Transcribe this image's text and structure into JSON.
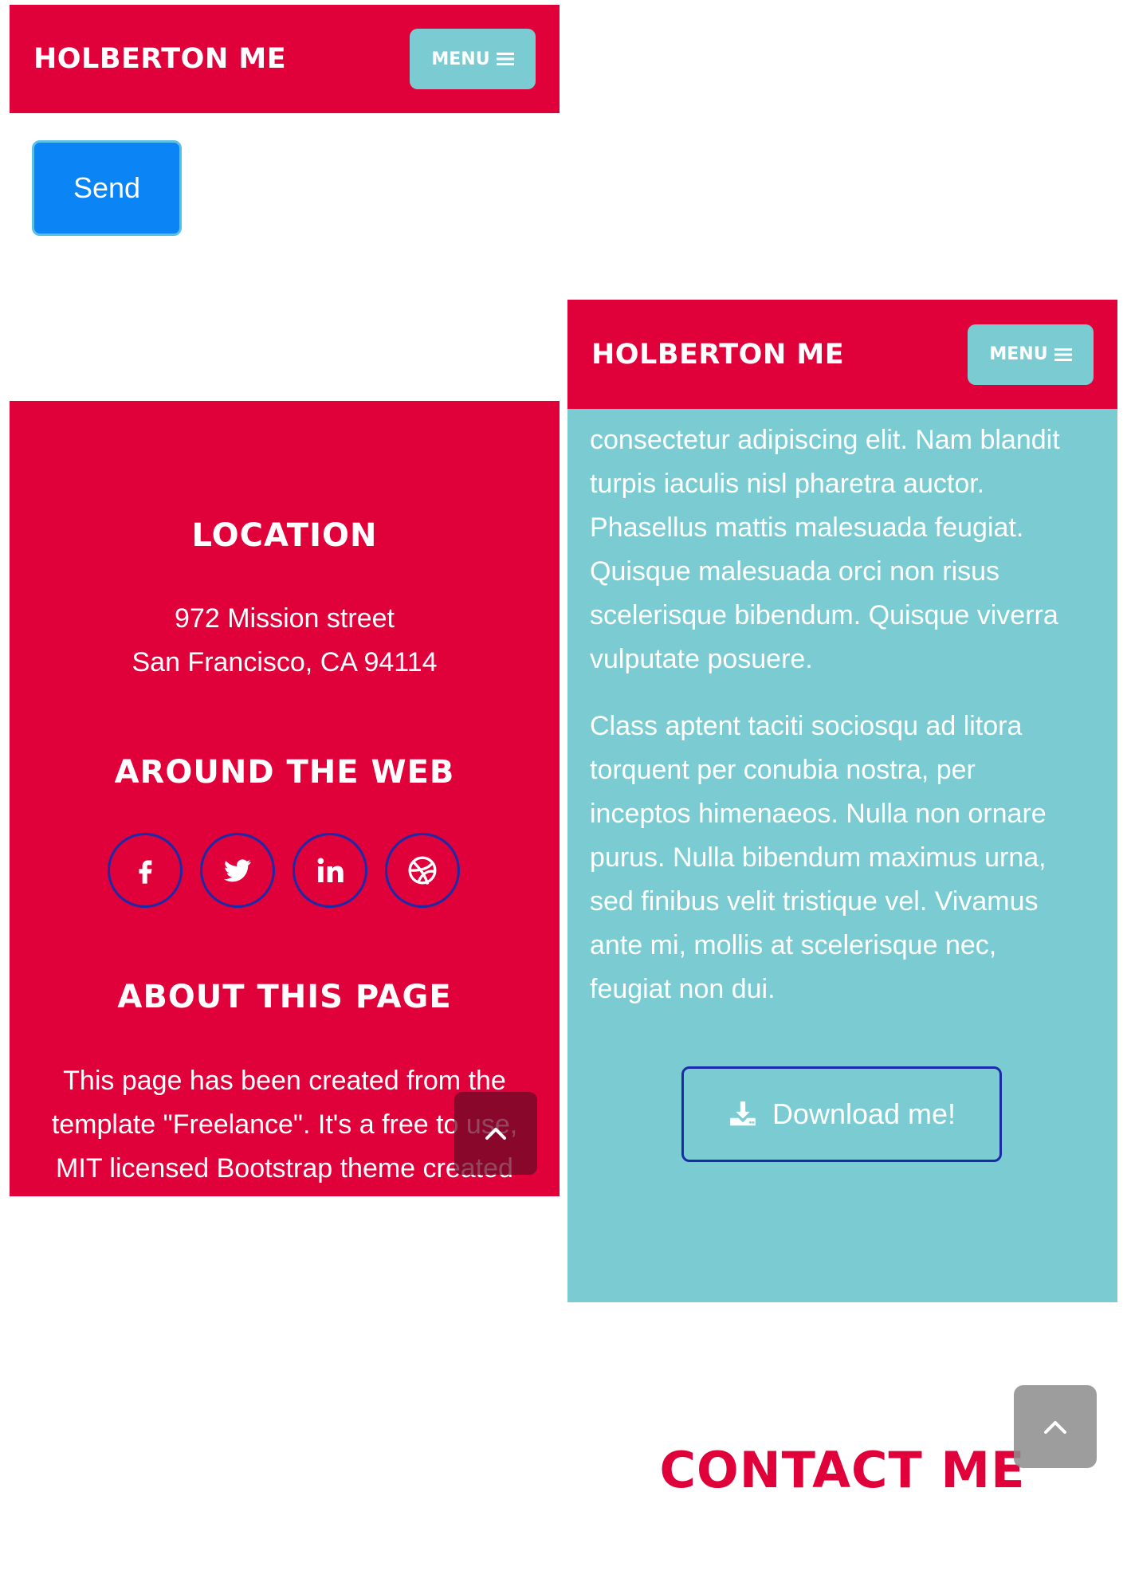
{
  "screen_1": {
    "navbar": {
      "brand": "HOLBERTON ME",
      "menu_label": "MENU"
    },
    "send_label": "Send"
  },
  "footer": {
    "location": {
      "heading": "LOCATION",
      "line1": "972 Mission street",
      "line2": "San Francisco, CA 94114"
    },
    "web": {
      "heading": "AROUND THE WEB",
      "social_icons": [
        "facebook-icon",
        "twitter-icon",
        "linkedin-icon",
        "dribbble-icon"
      ]
    },
    "about": {
      "heading": "ABOUT THIS PAGE",
      "lines": [
        "This page has been created from the",
        "template \"Freelance\". It's a free to use,",
        "MIT licensed Bootstrap theme created"
      ]
    }
  },
  "screen_2": {
    "navbar": {
      "brand": "HOLBERTON ME",
      "menu_label": "MENU"
    },
    "about": {
      "paragraph1_lines": [
        "consectetur adipiscing elit. Nam blandit",
        "turpis iaculis nisl pharetra auctor.",
        "Phasellus mattis malesuada feugiat.",
        "Quisque malesuada orci non risus",
        "scelerisque bibendum. Quisque viverra",
        "vulputate posuere."
      ],
      "paragraph2_lines": [
        "Class aptent taciti sociosqu ad litora",
        "torquent per conubia nostra, per",
        "inceptos himenaeos. Nulla non ornare",
        "purus. Nulla bibendum maximus urna,",
        "sed finibus velit tristique vel. Vivamus",
        "ante mi, mollis at scelerisque nec,",
        "feugiat non dui."
      ],
      "download_label": "Download me!"
    },
    "contact_heading": "CONTACT ME"
  },
  "colors": {
    "primary_red": "#e0003a",
    "teal": "#7accd2",
    "send_blue": "#0b84f5",
    "outline_navy": "#1a2aa8"
  }
}
